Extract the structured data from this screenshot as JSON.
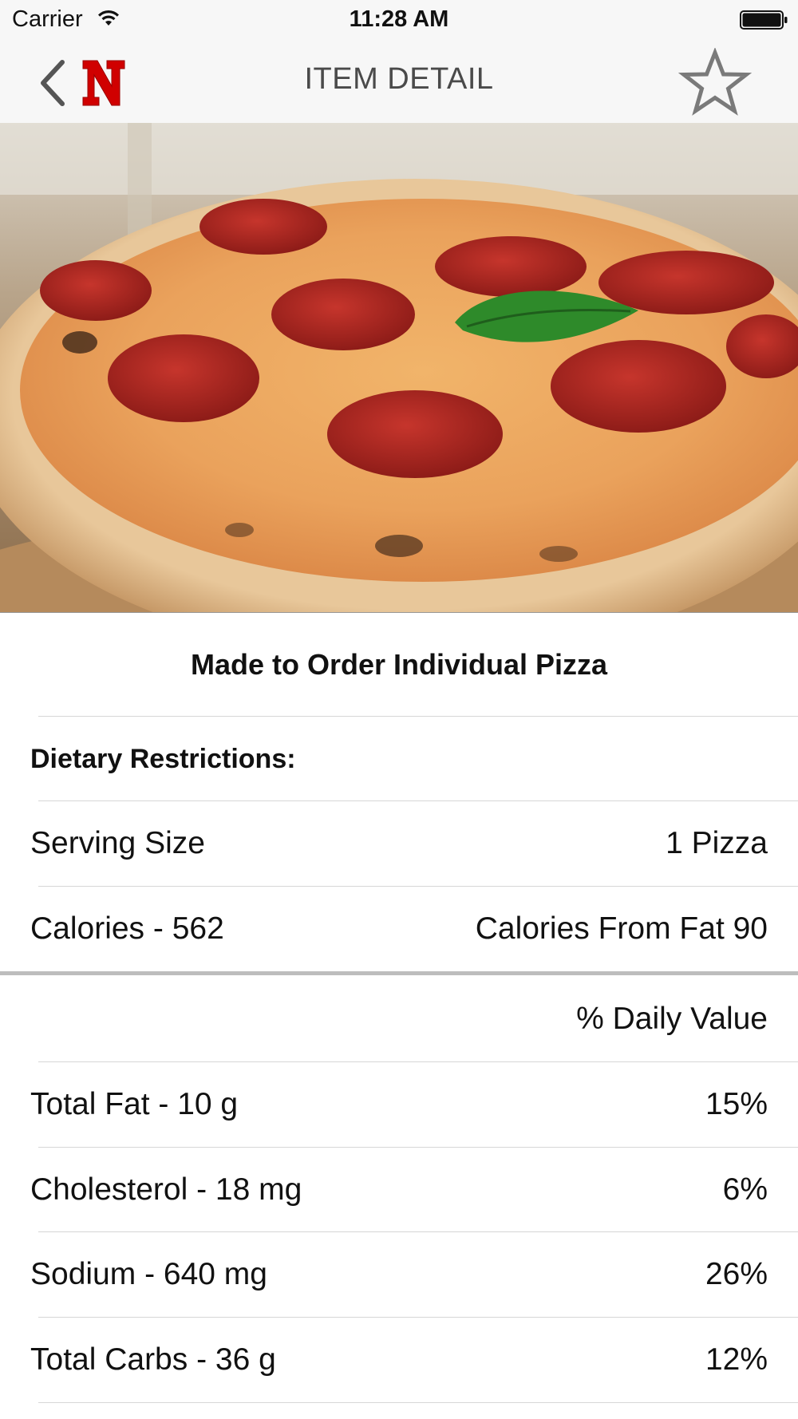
{
  "status_bar": {
    "carrier": "Carrier",
    "time": "11:28 AM"
  },
  "nav": {
    "title": "ITEM DETAIL",
    "logo_letter": "N",
    "brand_color": "#d00000",
    "back_icon": "chevron-left-icon",
    "favorite_icon": "star-outline-icon"
  },
  "item": {
    "name": "Made to Order Individual Pizza",
    "image_subject": "pepperoni pizza"
  },
  "details": {
    "dietary_label": "Dietary Restrictions:",
    "serving_size_label": "Serving Size",
    "serving_size_value": "1 Pizza",
    "calories_label": "Calories - 562",
    "calories_from_fat": "Calories From Fat 90"
  },
  "nutrition": {
    "daily_value_header": "% Daily Value",
    "rows": [
      {
        "label": "Total Fat - 10 g",
        "value": "15%"
      },
      {
        "label": "Cholesterol - 18 mg",
        "value": "6%"
      },
      {
        "label": "Sodium - 640 mg",
        "value": "26%"
      },
      {
        "label": "Total Carbs - 36 g",
        "value": "12%"
      }
    ]
  }
}
